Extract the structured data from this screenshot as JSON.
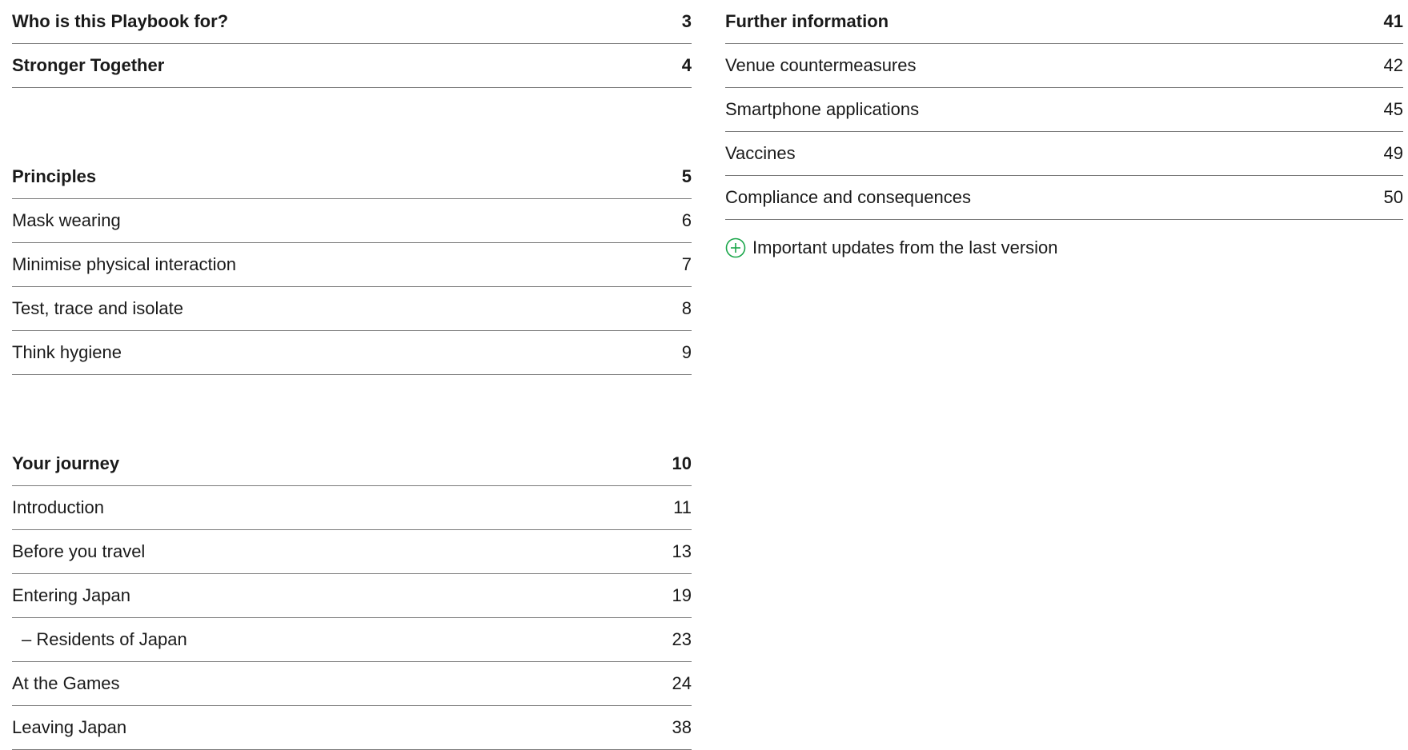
{
  "left": {
    "sections": [
      {
        "items": [
          {
            "label": "Who is this Playbook for?",
            "page": "3",
            "heading": true
          },
          {
            "label": "Stronger Together",
            "page": "4",
            "heading": true
          }
        ]
      },
      {
        "items": [
          {
            "label": "Principles",
            "page": "5",
            "heading": true
          },
          {
            "label": "Mask wearing",
            "page": "6"
          },
          {
            "label": "Minimise physical interaction",
            "page": "7"
          },
          {
            "label": "Test, trace and isolate",
            "page": "8"
          },
          {
            "label": "Think hygiene",
            "page": "9"
          }
        ]
      },
      {
        "items": [
          {
            "label": "Your journey",
            "page": "10",
            "heading": true
          },
          {
            "label": "Introduction",
            "page": "11"
          },
          {
            "label": "Before you travel",
            "page": "13"
          },
          {
            "label": "Entering Japan",
            "page": "19"
          },
          {
            "label": "– Residents of Japan",
            "page": "23",
            "sub": true
          },
          {
            "label": "At the Games",
            "page": "24"
          },
          {
            "label": "Leaving Japan",
            "page": "38"
          }
        ]
      }
    ]
  },
  "right": {
    "items": [
      {
        "label": "Further information",
        "page": "41",
        "heading": true
      },
      {
        "label": "Venue countermeasures",
        "page": "42"
      },
      {
        "label": "Smartphone applications",
        "page": "45"
      },
      {
        "label": "Vaccines",
        "page": "49"
      },
      {
        "label": "Compliance and consequences",
        "page": "50"
      }
    ],
    "note": {
      "icon": "plus-circle-icon",
      "text": "Important updates from the last version",
      "icon_color": "#1aa64a"
    }
  }
}
